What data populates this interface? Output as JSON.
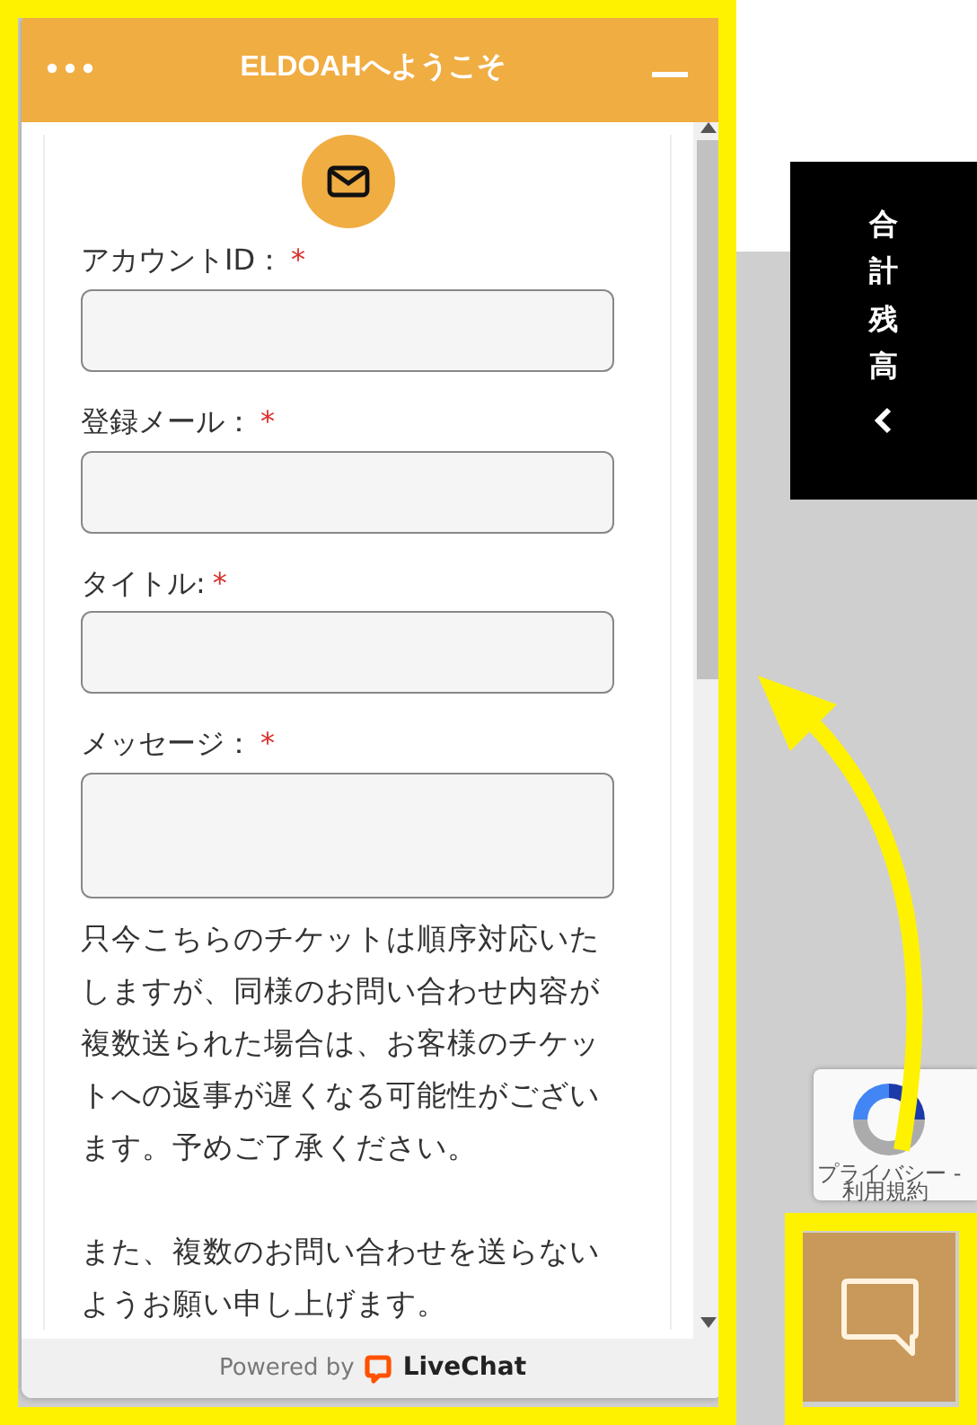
{
  "widget": {
    "title": "ELDOAHへようこそ",
    "fields": [
      {
        "label": "アカウントID：",
        "required": "*",
        "kind": "input"
      },
      {
        "label": "登録メール：",
        "required": "*",
        "kind": "input"
      },
      {
        "label": "タイトル:",
        "required": "*",
        "kind": "input"
      },
      {
        "label": "メッセージ：",
        "required": "*",
        "kind": "textarea"
      }
    ],
    "notice": [
      "只今こちらのチケットは順序対応いたしますが、同様のお問い合わせ内容が複数送られた場合は、お客様のチケットへの返事が遅くなる可能性がございます。予めご了承ください。",
      "また、複数のお問い合わせを送らないようお願い申し上げます。"
    ],
    "footer": {
      "prefix": "Powered by",
      "brand": "LiveChat"
    }
  },
  "side_tab": {
    "label": "合計残高"
  },
  "recaptcha": {
    "privacy": "プライバシー -",
    "terms": "利用規約"
  }
}
